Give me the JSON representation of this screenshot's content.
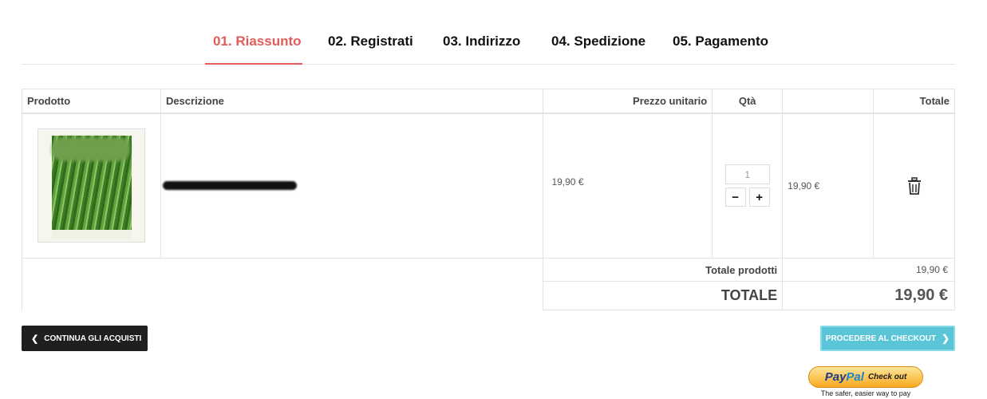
{
  "steps": [
    {
      "label": "01. Riassunto",
      "active": true
    },
    {
      "label": "02. Registrati",
      "active": false
    },
    {
      "label": "03. Indirizzo",
      "active": false
    },
    {
      "label": "04. Spedizione",
      "active": false
    },
    {
      "label": "05. Pagamento",
      "active": false
    }
  ],
  "accent_color": "#e15b5b",
  "table": {
    "headers": {
      "product": "Prodotto",
      "description": "Descrizione",
      "unit_price": "Prezzo unitario",
      "qty": "Qtà",
      "total": "Totale"
    },
    "items": [
      {
        "unit_price": "19,90 €",
        "quantity": "1",
        "line_total": "19,90 €",
        "decrement_label": "−",
        "increment_label": "+",
        "delete_icon": "trash-icon"
      }
    ]
  },
  "summary": {
    "subtotal_label": "Totale prodotti",
    "subtotal_value": "19,90 €",
    "total_label": "TOTALE",
    "total_value": "19,90 €"
  },
  "buttons": {
    "continue_label": "CONTINUA GLI ACQUISTI",
    "checkout_label": "PROCEDERE AL CHECKOUT",
    "checkout_color": "#5bc5d8"
  },
  "paypal": {
    "logo_pay": "Pay",
    "logo_pal": "Pal",
    "checkout": "Check out",
    "tagline": "The safer, easier way to pay"
  }
}
